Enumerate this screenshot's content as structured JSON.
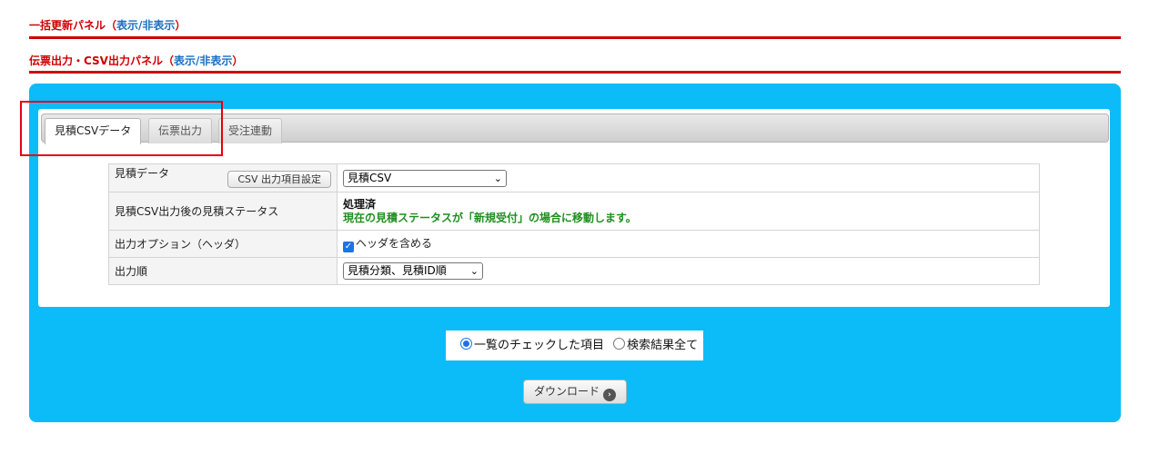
{
  "panels": [
    {
      "title": "一括更新パネル",
      "toggle": "表示/非表示",
      "open_paren": "（",
      "close_paren": "）"
    },
    {
      "title": "伝票出力・CSV出力パネル",
      "toggle": "表示/非表示",
      "open_paren": "（",
      "close_paren": "）"
    }
  ],
  "tabs": [
    {
      "label": "見積CSVデータ",
      "active": true
    },
    {
      "label": "伝票出力",
      "active": false
    },
    {
      "label": "受注連動",
      "active": false
    }
  ],
  "rows": {
    "quote_data": {
      "label": "見積データ",
      "button": "CSV 出力項目設定",
      "select_value": "見積CSV"
    },
    "status_after": {
      "label": "見積CSV出力後の見積ステータス",
      "line1": "処理済",
      "line2": "現在の見積ステータスが「新規受付」の場合に移動します。"
    },
    "output_option": {
      "label": "出力オプション（ヘッダ）",
      "checkbox_label": "ヘッダを含める",
      "checked": true
    },
    "output_order": {
      "label": "出力順",
      "select_value": "見積分類、見積ID順"
    }
  },
  "scope": {
    "options": [
      {
        "label": "一覧のチェックした項目",
        "selected": true
      },
      {
        "label": "検索結果全て",
        "selected": false
      }
    ]
  },
  "download": {
    "label": "ダウンロード"
  },
  "colors": {
    "panel_bg": "#0bbcf8",
    "header_red": "#d00000",
    "link_blue": "#1a6fc0",
    "status_green": "#1f8f1f",
    "highlight_red": "#e8000f"
  }
}
